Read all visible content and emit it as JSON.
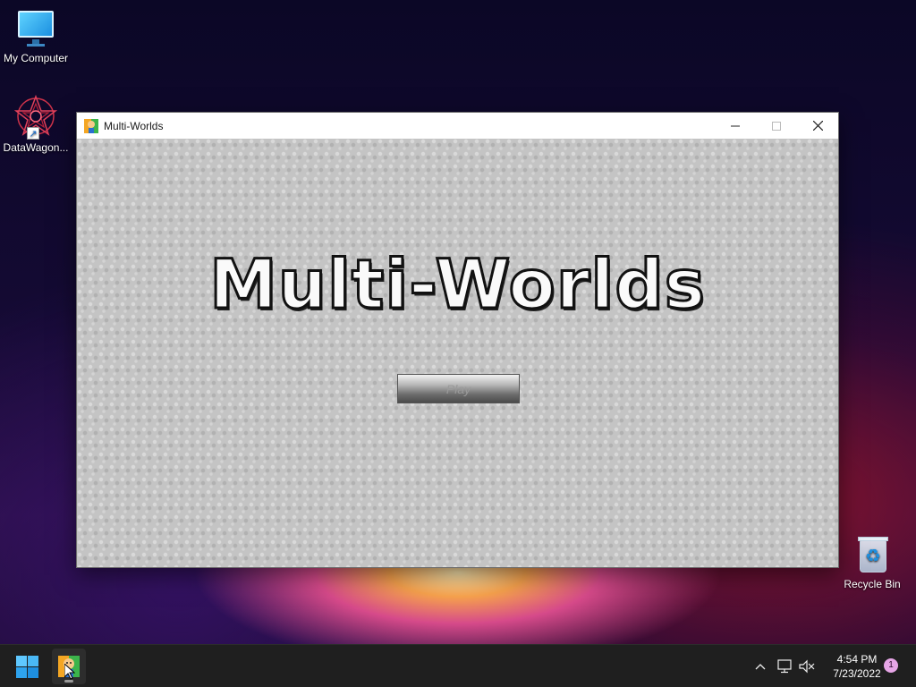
{
  "desktop": {
    "icons": [
      {
        "label": "My Computer",
        "icon": "monitor-icon"
      },
      {
        "label": "DataWagon...",
        "icon": "datawagon-icon"
      },
      {
        "label": "Recycle Bin",
        "icon": "recycle-bin-icon"
      }
    ]
  },
  "window": {
    "title": "Multi-Worlds",
    "controls": {
      "minimize": "minimize-icon",
      "maximize": "maximize-icon",
      "close": "close-icon"
    }
  },
  "game": {
    "title": "Multi-Worlds",
    "play_label": "Play"
  },
  "taskbar": {
    "start_icon": "windows-start-icon",
    "pinned_app": "multi-worlds-app-icon",
    "tray": {
      "chevron": "chevron-up-icon",
      "network": "network-icon",
      "volume": "volume-muted-icon"
    },
    "time": "4:54 PM",
    "date": "7/23/2022",
    "notification_count": "1"
  },
  "colors": {
    "accent": "#4cc2ff",
    "taskbar": "#1f1f1f",
    "content_bg": "#c4c4c4"
  }
}
